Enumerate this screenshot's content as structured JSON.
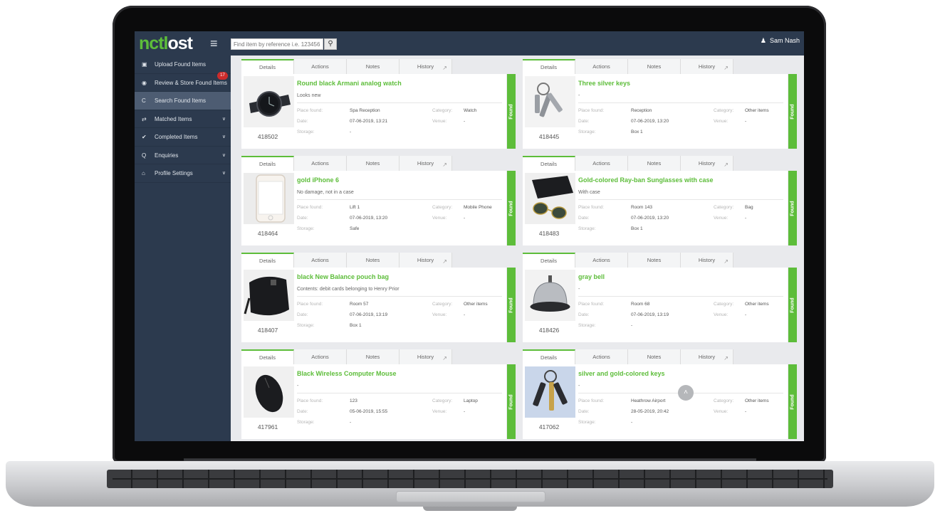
{
  "app": {
    "logo_a": "n",
    "logo_b": "c",
    "logo_c": "tl",
    "logo_d": "o",
    "logo_e": "st",
    "search_placeholder": "Find item by reference i.e. 123456",
    "user_name": "Sam Nash",
    "icons": {
      "menu": "hamburger-icon",
      "search": "search-icon",
      "user": "user-icon",
      "scroll_top": "chevron-up-icon"
    },
    "colors": {
      "accent": "#5dbd3a",
      "sidebar": "#2c3a4e",
      "badge": "#cc2b2b"
    }
  },
  "sidebar": {
    "items": [
      {
        "label": "Upload Found Items",
        "icon": "camera-icon"
      },
      {
        "label": "Review & Store Found Items",
        "icon": "eye-icon",
        "badge": "17"
      },
      {
        "label": "Search Found Items",
        "icon": "refresh-icon",
        "active": true
      },
      {
        "label": "Matched Items",
        "icon": "exchange-icon"
      },
      {
        "label": "Completed Items",
        "icon": "check-circle-icon"
      },
      {
        "label": "Enquiries",
        "icon": "magnifier-icon"
      },
      {
        "label": "Profile Settings",
        "icon": "bank-icon"
      }
    ]
  },
  "card_labels": {
    "tab_details": "Details",
    "tab_actions": "Actions",
    "tab_notes": "Notes",
    "tab_history": "History",
    "place_found": "Place found:",
    "date": "Date:",
    "storage": "Storage:",
    "category": "Category:",
    "venue": "Venue:",
    "status": "Found"
  },
  "items": [
    {
      "ref": "418502",
      "title": "Round black Armani analog watch",
      "desc": "Looks new",
      "place": "Spa Reception",
      "date": "07-06-2019, 13:21",
      "storage": "-",
      "category": "Watch",
      "venue": "-",
      "photo": "watch"
    },
    {
      "ref": "418445",
      "title": "Three silver keys",
      "desc": "-",
      "place": "Reception",
      "date": "07-06-2019, 13:20",
      "storage": "Box 1",
      "category": "Other items",
      "venue": "-",
      "photo": "keys"
    },
    {
      "ref": "418464",
      "title": "gold iPhone 6",
      "desc": "No damage, not in a case",
      "place": "Lift 1",
      "date": "07-06-2019, 13:20",
      "storage": "Safe",
      "category": "Mobile Phone",
      "venue": "-",
      "photo": "phone"
    },
    {
      "ref": "418483",
      "title": "Gold-colored Ray-ban Sunglasses with case",
      "desc": "With case",
      "place": "Room 143",
      "date": "07-06-2019, 13:20",
      "storage": "Box 1",
      "category": "Bag",
      "venue": "-",
      "photo": "sunglasses"
    },
    {
      "ref": "418407",
      "title": "black New Balance pouch bag",
      "desc": "Contents: debit cards belonging to Henry Prior",
      "place": "Room 57",
      "date": "07-06-2019, 13:19",
      "storage": "Box 1",
      "category": "Other items",
      "venue": "-",
      "photo": "pouch"
    },
    {
      "ref": "418426",
      "title": "gray bell",
      "desc": "-",
      "place": "Room 68",
      "date": "07-06-2019, 13:19",
      "storage": "-",
      "category": "Other items",
      "venue": "-",
      "photo": "bell"
    },
    {
      "ref": "417961",
      "title": "Black Wireless Computer Mouse",
      "desc": "-",
      "place": "123",
      "date": "05-06-2019, 15:55",
      "storage": "-",
      "category": "Laptop",
      "venue": "-",
      "photo": "mouse"
    },
    {
      "ref": "417062",
      "title": "silver and gold-colored keys",
      "desc": "-",
      "place": "Heathrow Airport",
      "date": "28-05-2019, 20:42",
      "storage": "-",
      "category": "Other items",
      "venue": "-",
      "photo": "keys2"
    }
  ]
}
